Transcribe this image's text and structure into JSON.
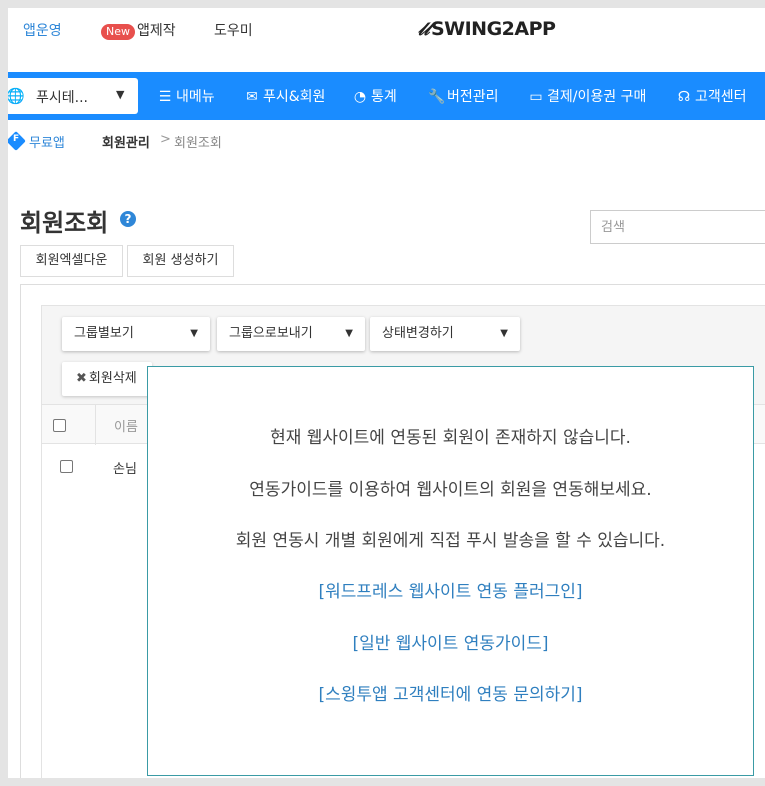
{
  "topnav": {
    "operate": "앱운영",
    "new_badge": "New",
    "make": "앱제작",
    "help": "도우미",
    "logo": "SWING2APP"
  },
  "menubar": {
    "app_selector": "푸시테...",
    "items": [
      {
        "icon": "menu-icon",
        "label": "내메뉴"
      },
      {
        "icon": "mail-icon",
        "label": "푸시&회원"
      },
      {
        "icon": "pie-chart-icon",
        "label": "통계"
      },
      {
        "icon": "wrench-icon",
        "label": "버전관리"
      },
      {
        "icon": "card-icon",
        "label": "결제/이용권 구매"
      },
      {
        "icon": "headset-icon",
        "label": "고객센터"
      }
    ]
  },
  "breadcrumb": {
    "badge": "F",
    "app": "무료앱",
    "section": "회원관리",
    "separator": ">",
    "current": "회원조회"
  },
  "page": {
    "title": "회원조회",
    "help_icon": "?",
    "search_placeholder": "검색",
    "excel_button": "회원엑셀다운",
    "create_button": "회원 생성하기"
  },
  "toolbar": {
    "group_view": "그룹별보기",
    "send_to_group": "그룹으로보내기",
    "change_status": "상태변경하기",
    "delete": "회원삭제"
  },
  "table": {
    "header_name": "이름",
    "rows": [
      {
        "name": "손님"
      }
    ]
  },
  "overlay": {
    "line1": "현재 웹사이트에 연동된 회원이 존재하지 않습니다.",
    "line2": "연동가이드를 이용하여 웹사이트의 회원을 연동해보세요.",
    "line3": "회원 연동시 개별 회원에게 직접 푸시 발송을 할 수 있습니다.",
    "link1": "[워드프레스 웹사이트 연동 플러그인]",
    "link2": "[일반 웹사이트 연동가이드]",
    "link3": "[스윙투앱 고객센터에 연동 문의하기]"
  },
  "colors": {
    "accent": "#1a8cff",
    "link": "#2f7fbf",
    "badge": "#e8504d",
    "overlay_border": "#3a9ba5"
  }
}
